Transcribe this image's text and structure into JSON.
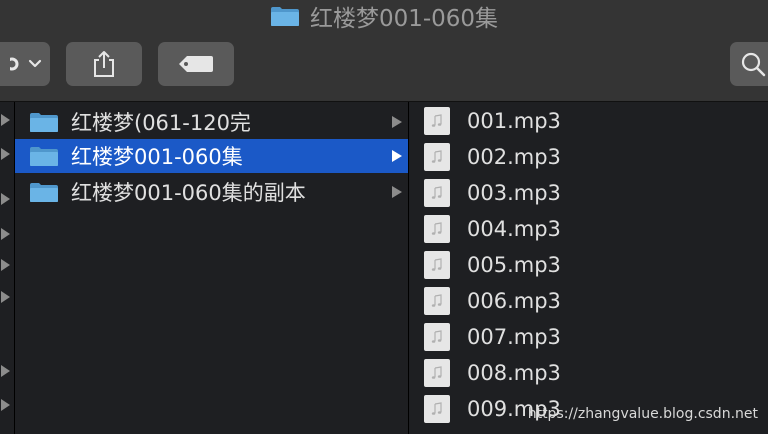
{
  "window": {
    "title": "红楼梦001-060集"
  },
  "toolbar": {
    "action_icon": "gear-icon",
    "action_dropdown_icon": "chevron-down-icon",
    "share_icon": "share-icon",
    "tag_icon": "tag-icon",
    "search_icon": "search-icon"
  },
  "middle_column": {
    "items": [
      {
        "label": "红楼梦(061-120完",
        "type": "folder",
        "selected": false
      },
      {
        "label": "红楼梦001-060集",
        "type": "folder",
        "selected": true
      },
      {
        "label": "红楼梦001-060集的副本",
        "type": "folder",
        "selected": false
      }
    ]
  },
  "right_column": {
    "items": [
      {
        "label": "001.mp3",
        "type": "audio-file"
      },
      {
        "label": "002.mp3",
        "type": "audio-file"
      },
      {
        "label": "003.mp3",
        "type": "audio-file"
      },
      {
        "label": "004.mp3",
        "type": "audio-file"
      },
      {
        "label": "005.mp3",
        "type": "audio-file"
      },
      {
        "label": "006.mp3",
        "type": "audio-file"
      },
      {
        "label": "007.mp3",
        "type": "audio-file"
      },
      {
        "label": "008.mp3",
        "type": "audio-file"
      },
      {
        "label": "009.mp3",
        "type": "audio-file"
      }
    ]
  },
  "watermark": {
    "text": "https://zhangvalue.blog.csdn.net"
  },
  "colors": {
    "selection": "#1b59c7",
    "folder": "#5aa6db",
    "toolbar_bg": "#343434",
    "button_bg": "#5a5a5a"
  }
}
